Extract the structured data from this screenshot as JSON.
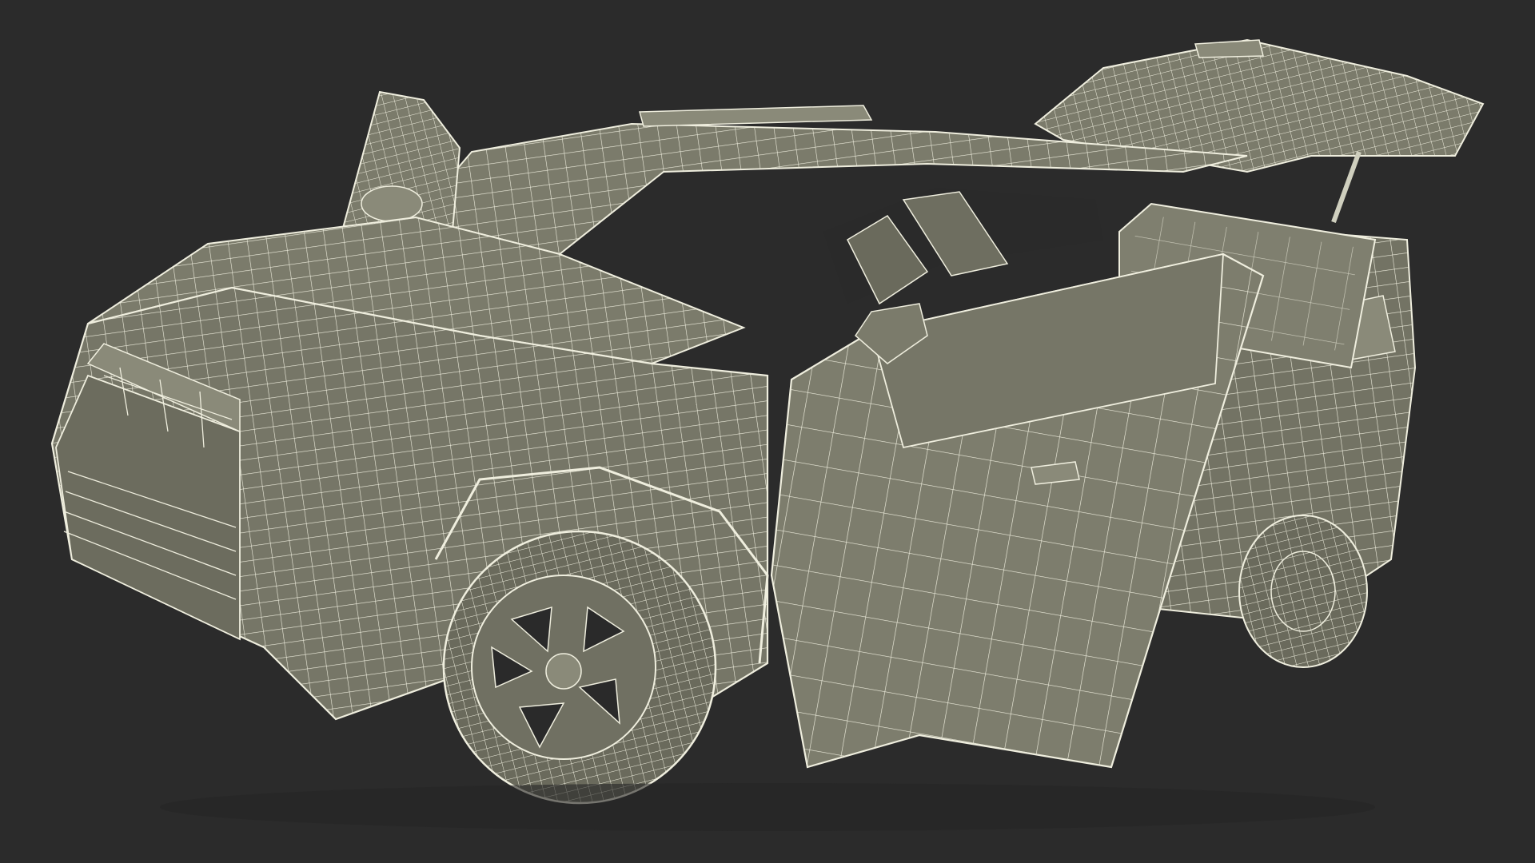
{
  "scene": {
    "subject": "suv-wireframe-render",
    "colors": {
      "background": "#2b2b2b",
      "surface": "#7b7b6b",
      "surface_dark": "#5f5f52",
      "surface_light": "#8a8a79",
      "wire": "#efeede",
      "void": "#2a2a2a"
    },
    "visible_text": []
  }
}
